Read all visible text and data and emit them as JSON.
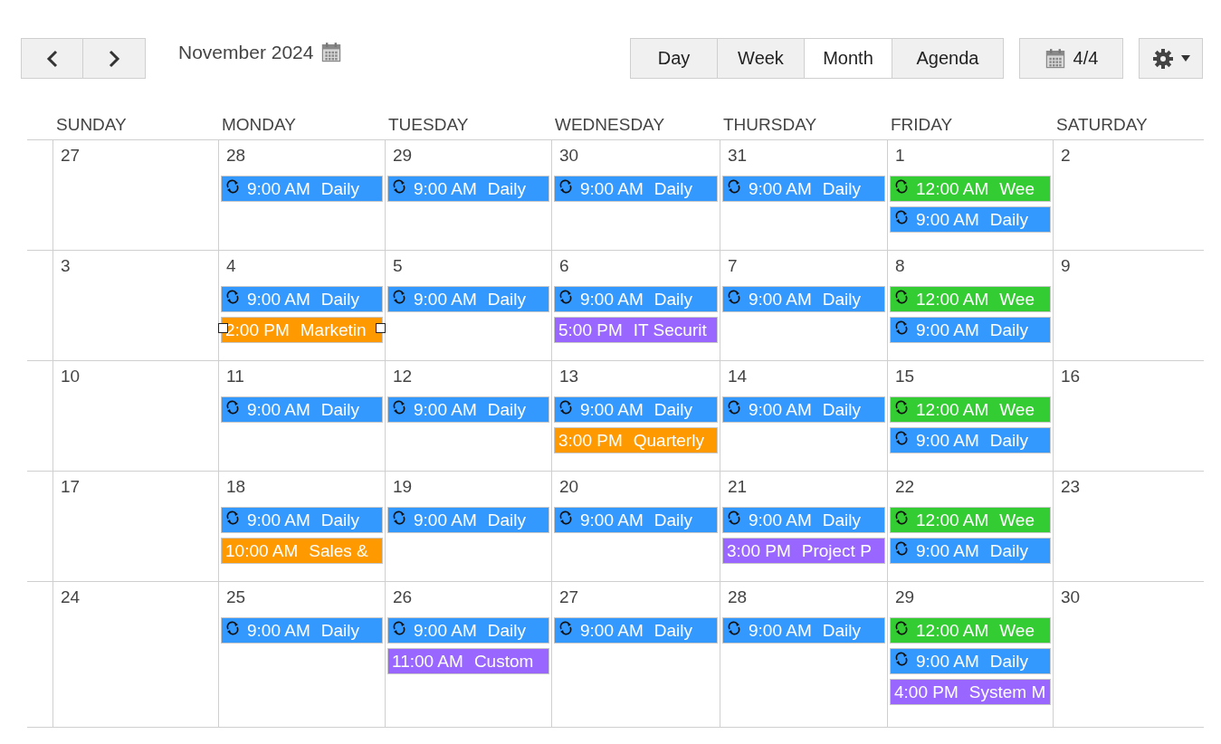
{
  "toolbar": {
    "title": "November 2024",
    "views": [
      {
        "label": "Day",
        "selected": false
      },
      {
        "label": "Week",
        "selected": false
      },
      {
        "label": "Month",
        "selected": true
      },
      {
        "label": "Agenda",
        "selected": false
      }
    ],
    "counter": "4/4"
  },
  "weekdays": [
    "SUNDAY",
    "MONDAY",
    "TUESDAY",
    "WEDNESDAY",
    "THURSDAY",
    "FRIDAY",
    "SATURDAY"
  ],
  "weeks": [
    {
      "days": [
        {
          "day": "27"
        },
        {
          "day": "28",
          "events": [
            {
              "time": "9:00 AM",
              "title": "Daily",
              "color": "#3399ff",
              "recurring": true,
              "selected": false
            }
          ]
        },
        {
          "day": "29",
          "events": [
            {
              "time": "9:00 AM",
              "title": "Daily",
              "color": "#3399ff",
              "recurring": true,
              "selected": false
            }
          ]
        },
        {
          "day": "30",
          "events": [
            {
              "time": "9:00 AM",
              "title": "Daily",
              "color": "#3399ff",
              "recurring": true,
              "selected": false
            }
          ]
        },
        {
          "day": "31",
          "events": [
            {
              "time": "9:00 AM",
              "title": "Daily",
              "color": "#3399ff",
              "recurring": true,
              "selected": false
            }
          ]
        },
        {
          "day": "1",
          "events": [
            {
              "time": "12:00 AM",
              "title": "Wee",
              "color": "#33cc33",
              "recurring": true,
              "selected": false
            },
            {
              "time": "9:00 AM",
              "title": "Daily",
              "color": "#3399ff",
              "recurring": true,
              "selected": false
            }
          ]
        },
        {
          "day": "2"
        }
      ]
    },
    {
      "days": [
        {
          "day": "3"
        },
        {
          "day": "4",
          "events": [
            {
              "time": "9:00 AM",
              "title": "Daily",
              "color": "#3399ff",
              "recurring": true,
              "selected": false
            },
            {
              "time": "2:00 PM",
              "title": "Marketin",
              "color": "#ff9900",
              "recurring": false,
              "selected": true
            }
          ]
        },
        {
          "day": "5",
          "events": [
            {
              "time": "9:00 AM",
              "title": "Daily",
              "color": "#3399ff",
              "recurring": true,
              "selected": false
            }
          ]
        },
        {
          "day": "6",
          "events": [
            {
              "time": "9:00 AM",
              "title": "Daily",
              "color": "#3399ff",
              "recurring": true,
              "selected": false
            },
            {
              "time": "5:00 PM",
              "title": "IT Securit",
              "color": "#9966ff",
              "recurring": false,
              "selected": false
            }
          ]
        },
        {
          "day": "7",
          "events": [
            {
              "time": "9:00 AM",
              "title": "Daily",
              "color": "#3399ff",
              "recurring": true,
              "selected": false
            }
          ]
        },
        {
          "day": "8",
          "events": [
            {
              "time": "12:00 AM",
              "title": "Wee",
              "color": "#33cc33",
              "recurring": true,
              "selected": false
            },
            {
              "time": "9:00 AM",
              "title": "Daily",
              "color": "#3399ff",
              "recurring": true,
              "selected": false
            }
          ]
        },
        {
          "day": "9"
        }
      ]
    },
    {
      "days": [
        {
          "day": "10"
        },
        {
          "day": "11",
          "events": [
            {
              "time": "9:00 AM",
              "title": "Daily",
              "color": "#3399ff",
              "recurring": true,
              "selected": false
            }
          ]
        },
        {
          "day": "12",
          "events": [
            {
              "time": "9:00 AM",
              "title": "Daily",
              "color": "#3399ff",
              "recurring": true,
              "selected": false
            }
          ]
        },
        {
          "day": "13",
          "events": [
            {
              "time": "9:00 AM",
              "title": "Daily",
              "color": "#3399ff",
              "recurring": true,
              "selected": false
            },
            {
              "time": "3:00 PM",
              "title": "Quarterly",
              "color": "#ff9900",
              "recurring": false,
              "selected": false
            }
          ]
        },
        {
          "day": "14",
          "events": [
            {
              "time": "9:00 AM",
              "title": "Daily",
              "color": "#3399ff",
              "recurring": true,
              "selected": false
            }
          ]
        },
        {
          "day": "15",
          "events": [
            {
              "time": "12:00 AM",
              "title": "Wee",
              "color": "#33cc33",
              "recurring": true,
              "selected": false
            },
            {
              "time": "9:00 AM",
              "title": "Daily",
              "color": "#3399ff",
              "recurring": true,
              "selected": false
            }
          ]
        },
        {
          "day": "16"
        }
      ]
    },
    {
      "days": [
        {
          "day": "17"
        },
        {
          "day": "18",
          "events": [
            {
              "time": "9:00 AM",
              "title": "Daily",
              "color": "#3399ff",
              "recurring": true,
              "selected": false
            },
            {
              "time": "10:00 AM",
              "title": "Sales &",
              "color": "#ff9900",
              "recurring": false,
              "selected": false
            }
          ]
        },
        {
          "day": "19",
          "events": [
            {
              "time": "9:00 AM",
              "title": "Daily",
              "color": "#3399ff",
              "recurring": true,
              "selected": false
            }
          ]
        },
        {
          "day": "20",
          "events": [
            {
              "time": "9:00 AM",
              "title": "Daily",
              "color": "#3399ff",
              "recurring": true,
              "selected": false
            }
          ]
        },
        {
          "day": "21",
          "events": [
            {
              "time": "9:00 AM",
              "title": "Daily",
              "color": "#3399ff",
              "recurring": true,
              "selected": false
            },
            {
              "time": "3:00 PM",
              "title": "Project P",
              "color": "#9966ff",
              "recurring": false,
              "selected": false
            }
          ]
        },
        {
          "day": "22",
          "events": [
            {
              "time": "12:00 AM",
              "title": "Wee",
              "color": "#33cc33",
              "recurring": true,
              "selected": false
            },
            {
              "time": "9:00 AM",
              "title": "Daily",
              "color": "#3399ff",
              "recurring": true,
              "selected": false
            }
          ]
        },
        {
          "day": "23"
        }
      ]
    },
    {
      "days": [
        {
          "day": "24"
        },
        {
          "day": "25",
          "events": [
            {
              "time": "9:00 AM",
              "title": "Daily",
              "color": "#3399ff",
              "recurring": true,
              "selected": false
            }
          ]
        },
        {
          "day": "26",
          "events": [
            {
              "time": "9:00 AM",
              "title": "Daily",
              "color": "#3399ff",
              "recurring": true,
              "selected": false
            },
            {
              "time": "11:00 AM",
              "title": "Custom",
              "color": "#9966ff",
              "recurring": false,
              "selected": false
            }
          ]
        },
        {
          "day": "27",
          "events": [
            {
              "time": "9:00 AM",
              "title": "Daily",
              "color": "#3399ff",
              "recurring": true,
              "selected": false
            }
          ]
        },
        {
          "day": "28",
          "events": [
            {
              "time": "9:00 AM",
              "title": "Daily",
              "color": "#3399ff",
              "recurring": true,
              "selected": false
            }
          ]
        },
        {
          "day": "29",
          "events": [
            {
              "time": "12:00 AM",
              "title": "Wee",
              "color": "#33cc33",
              "recurring": true,
              "selected": false
            },
            {
              "time": "9:00 AM",
              "title": "Daily",
              "color": "#3399ff",
              "recurring": true,
              "selected": false
            },
            {
              "time": "4:00 PM",
              "title": "System M",
              "color": "#9966ff",
              "recurring": false,
              "selected": false
            }
          ]
        },
        {
          "day": "30"
        }
      ]
    }
  ]
}
